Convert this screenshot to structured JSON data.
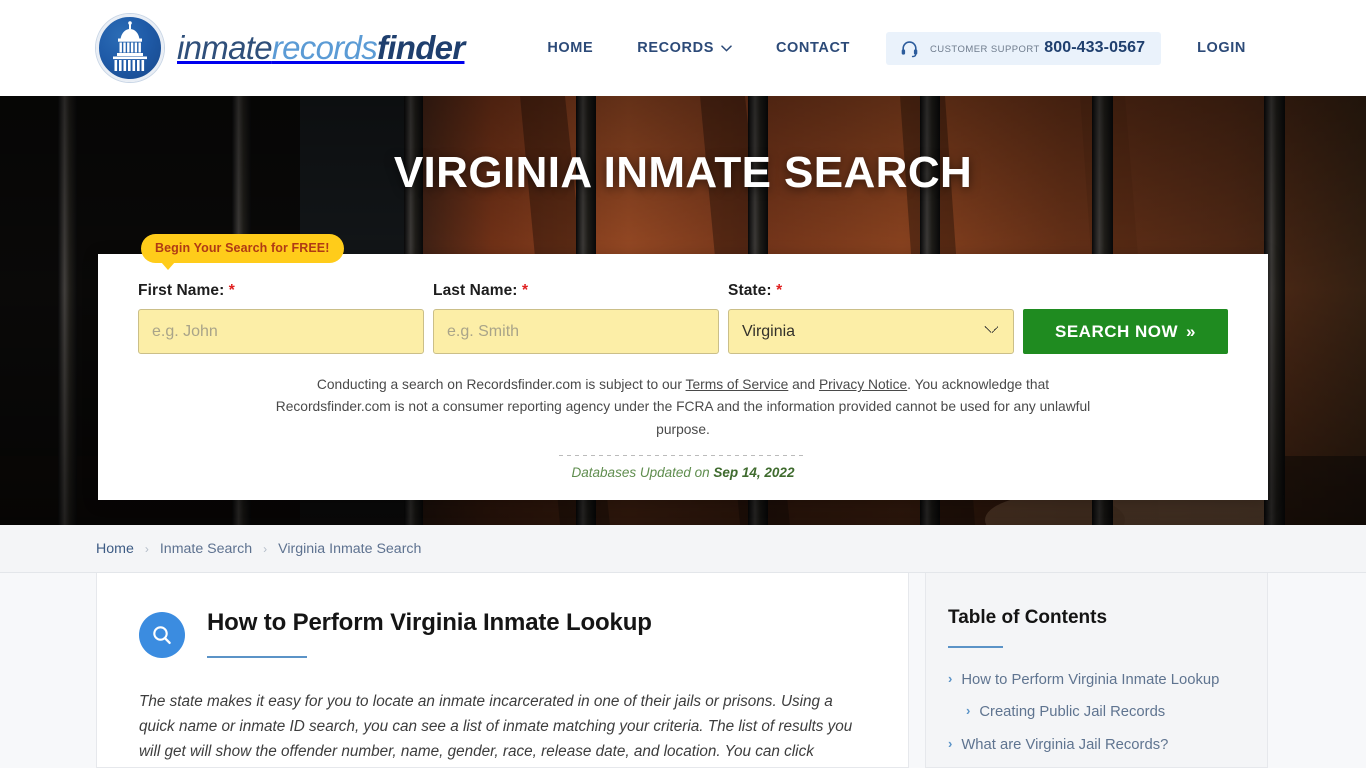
{
  "header": {
    "brand": {
      "part1": "inmate",
      "part2": "records",
      "part3": "finder",
      "logo_icon": "capitol-dome-icon"
    },
    "nav": [
      {
        "label": "HOME",
        "icon": ""
      },
      {
        "label": "RECORDS",
        "icon": "chevron-down-icon"
      },
      {
        "label": "CONTACT",
        "icon": ""
      }
    ],
    "support": {
      "icon": "headset-icon",
      "label": "CUSTOMER SUPPORT",
      "phone": "800-433-0567",
      "bg_color": "#eaf2fb"
    },
    "login_label": "LOGIN"
  },
  "hero": {
    "title": "VIRGINIA INMATE SEARCH",
    "badge": "Begin Your Search for FREE!",
    "badge_color": "#ffcc1a",
    "form": {
      "first_name": {
        "label": "First Name:",
        "required": "*",
        "placeholder": "e.g. John",
        "value": ""
      },
      "last_name": {
        "label": "Last Name:",
        "required": "*",
        "placeholder": "e.g. Smith",
        "value": ""
      },
      "state": {
        "label": "State:",
        "required": "*",
        "selected": "Virginia"
      },
      "submit_label": "SEARCH NOW",
      "submit_arrow": "»",
      "submit_color": "#1f8b20",
      "input_bg": "#fceea7"
    },
    "disclaimer": {
      "p1": "Conducting a search on Recordsfinder.com is subject to our ",
      "link1": "Terms of Service",
      "mid": " and ",
      "link2": "Privacy Notice",
      "p2": ". You acknowledge that Recordsfinder.com is not a consumer reporting agency under the FCRA and the information provided cannot be used for any unlawful purpose."
    },
    "updated_prefix": "Databases Updated on ",
    "updated_date": "Sep 14, 2022"
  },
  "breadcrumb": {
    "items": [
      "Home",
      "Inmate Search",
      "Virginia Inmate Search"
    ],
    "separator": "›"
  },
  "main": {
    "section": {
      "icon": "search-magnifier-icon",
      "title": "How to Perform Virginia Inmate Lookup",
      "body": "The state makes it easy for you to locate an inmate incarcerated in one of their jails or prisons. Using a quick name or inmate ID search, you can see a list of inmate matching your criteria. The list of results you will get will show the offender number, name, gender, race, release date, and location. You can click"
    },
    "toc": {
      "title": "Table of Contents",
      "items": [
        {
          "label": "How to Perform Virginia Inmate Lookup",
          "level": 0
        },
        {
          "label": "Creating Public Jail Records",
          "level": 1
        },
        {
          "label": "What are Virginia Jail Records?",
          "level": 0
        }
      ]
    }
  }
}
